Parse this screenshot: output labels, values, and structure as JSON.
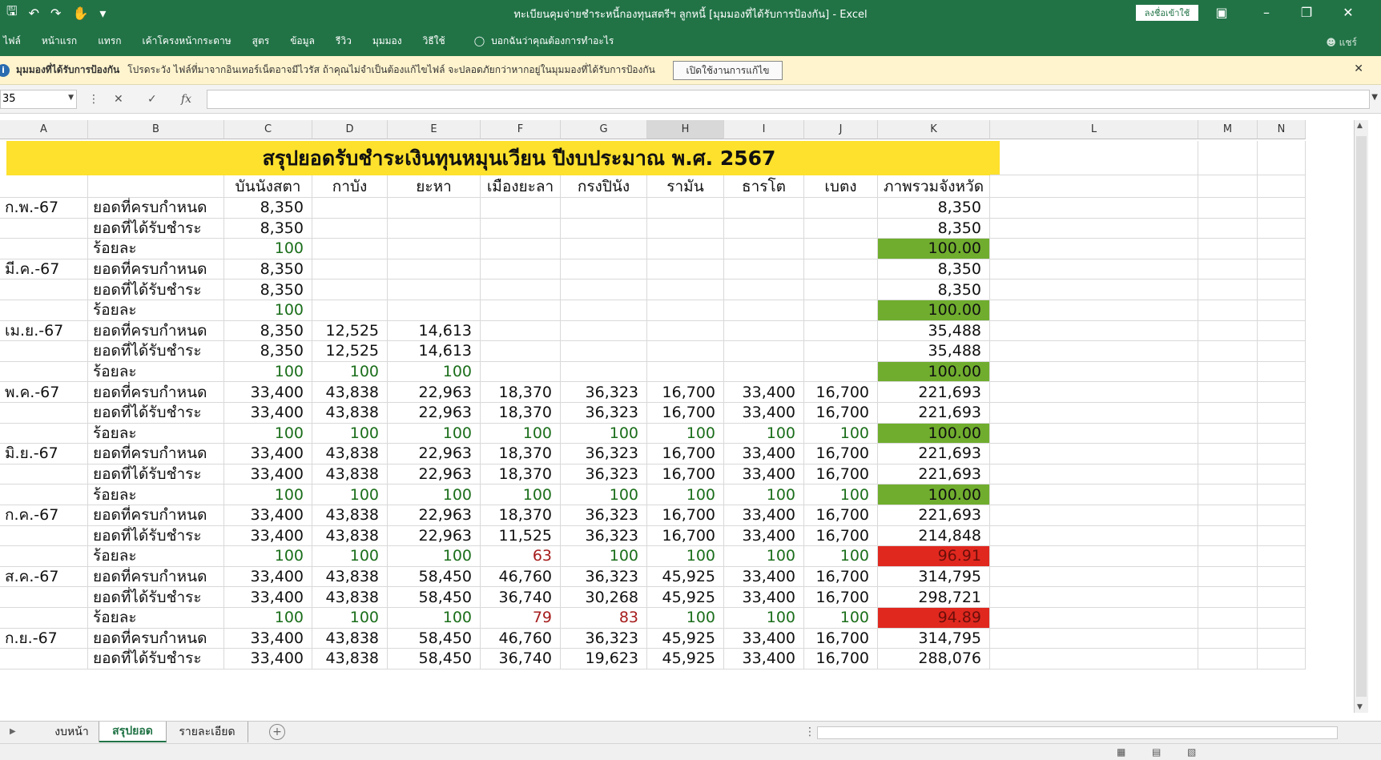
{
  "window": {
    "title": "ทะเบียนคุมจ่ายชำระหนี้กองทุนสตรีฯ ลูกหนี้  [มุมมองที่ได้รับการป้องกัน]  -  Excel",
    "signin_label": "ลงชื่อเข้าใช้"
  },
  "ribbon": {
    "tabs": [
      "ไฟล์",
      "หน้าแรก",
      "แทรก",
      "เค้าโครงหน้ากระดาษ",
      "สูตร",
      "ข้อมูล",
      "รีวิว",
      "มุมมอง",
      "วิธีใช้"
    ],
    "tell_me": "บอกฉันว่าคุณต้องการทำอะไร",
    "share": "แชร์"
  },
  "message_bar": {
    "title": "มุมมองที่ได้รับการป้องกัน",
    "text": "โปรดระวัง ไฟล์ที่มาจากอินเทอร์เน็ตอาจมีไวรัส ถ้าคุณไม่จำเป็นต้องแก้ไขไฟล์ จะปลอดภัยกว่าหากอยู่ในมุมมองที่ได้รับการป้องกัน",
    "button_label": "เปิดใช้งานการแก้ไข"
  },
  "formula_bar": {
    "name_box": "35",
    "formula": ""
  },
  "columns": [
    "A",
    "B",
    "C",
    "D",
    "E",
    "F",
    "G",
    "H",
    "I",
    "J",
    "K",
    "L",
    "M",
    "N"
  ],
  "selected_column": "H",
  "sheet": {
    "title": "สรุปยอดรับชำระเงินทุนหมุนเวียน ปีงบประมาณ พ.ศ. 2567",
    "headers": [
      "บันนังสตา",
      "กาบัง",
      "ยะหา",
      "เมืองยะลา",
      "กรงปินัง",
      "รามัน",
      "ธารโต",
      "เบตง",
      "ภาพรวมจังหวัด"
    ],
    "rows": [
      {
        "month": "ก.พ.-67",
        "label": "ยอดที่ครบกำหนด",
        "values": [
          "8,350",
          "",
          "",
          "",
          "",
          "",
          "",
          ""
        ],
        "total": "8,350",
        "kind": "amount"
      },
      {
        "month": "",
        "label": "ยอดที่ได้รับชำระ",
        "values": [
          "8,350",
          "",
          "",
          "",
          "",
          "",
          "",
          ""
        ],
        "total": "8,350",
        "kind": "amount"
      },
      {
        "month": "",
        "label": "ร้อยละ",
        "values": [
          "100",
          "",
          "",
          "",
          "",
          "",
          "",
          ""
        ],
        "total": "100.00",
        "kind": "pct",
        "status": "green"
      },
      {
        "month": "มี.ค.-67",
        "label": "ยอดที่ครบกำหนด",
        "values": [
          "8,350",
          "",
          "",
          "",
          "",
          "",
          "",
          ""
        ],
        "total": "8,350",
        "kind": "amount"
      },
      {
        "month": "",
        "label": "ยอดที่ได้รับชำระ",
        "values": [
          "8,350",
          "",
          "",
          "",
          "",
          "",
          "",
          ""
        ],
        "total": "8,350",
        "kind": "amount"
      },
      {
        "month": "",
        "label": "ร้อยละ",
        "values": [
          "100",
          "",
          "",
          "",
          "",
          "",
          "",
          ""
        ],
        "total": "100.00",
        "kind": "pct",
        "status": "green"
      },
      {
        "month": "เม.ย.-67",
        "label": "ยอดที่ครบกำหนด",
        "values": [
          "8,350",
          "12,525",
          "14,613",
          "",
          "",
          "",
          "",
          ""
        ],
        "total": "35,488",
        "kind": "amount"
      },
      {
        "month": "",
        "label": "ยอดที่ได้รับชำระ",
        "values": [
          "8,350",
          "12,525",
          "14,613",
          "",
          "",
          "",
          "",
          ""
        ],
        "total": "35,488",
        "kind": "amount"
      },
      {
        "month": "",
        "label": "ร้อยละ",
        "values": [
          "100",
          "100",
          "100",
          "",
          "",
          "",
          "",
          ""
        ],
        "total": "100.00",
        "kind": "pct",
        "status": "green"
      },
      {
        "month": "พ.ค.-67",
        "label": "ยอดที่ครบกำหนด",
        "values": [
          "33,400",
          "43,838",
          "22,963",
          "18,370",
          "36,323",
          "16,700",
          "33,400",
          "16,700"
        ],
        "total": "221,693",
        "kind": "amount"
      },
      {
        "month": "",
        "label": "ยอดที่ได้รับชำระ",
        "values": [
          "33,400",
          "43,838",
          "22,963",
          "18,370",
          "36,323",
          "16,700",
          "33,400",
          "16,700"
        ],
        "total": "221,693",
        "kind": "amount"
      },
      {
        "month": "",
        "label": "ร้อยละ",
        "values": [
          "100",
          "100",
          "100",
          "100",
          "100",
          "100",
          "100",
          "100"
        ],
        "total": "100.00",
        "kind": "pct",
        "status": "green"
      },
      {
        "month": "มิ.ย.-67",
        "label": "ยอดที่ครบกำหนด",
        "values": [
          "33,400",
          "43,838",
          "22,963",
          "18,370",
          "36,323",
          "16,700",
          "33,400",
          "16,700"
        ],
        "total": "221,693",
        "kind": "amount"
      },
      {
        "month": "",
        "label": "ยอดที่ได้รับชำระ",
        "values": [
          "33,400",
          "43,838",
          "22,963",
          "18,370",
          "36,323",
          "16,700",
          "33,400",
          "16,700"
        ],
        "total": "221,693",
        "kind": "amount"
      },
      {
        "month": "",
        "label": "ร้อยละ",
        "values": [
          "100",
          "100",
          "100",
          "100",
          "100",
          "100",
          "100",
          "100"
        ],
        "total": "100.00",
        "kind": "pct",
        "status": "green"
      },
      {
        "month": "ก.ค.-67",
        "label": "ยอดที่ครบกำหนด",
        "values": [
          "33,400",
          "43,838",
          "22,963",
          "18,370",
          "36,323",
          "16,700",
          "33,400",
          "16,700"
        ],
        "total": "221,693",
        "kind": "amount"
      },
      {
        "month": "",
        "label": "ยอดที่ได้รับชำระ",
        "values": [
          "33,400",
          "43,838",
          "22,963",
          "11,525",
          "36,323",
          "16,700",
          "33,400",
          "16,700"
        ],
        "total": "214,848",
        "kind": "amount"
      },
      {
        "month": "",
        "label": "ร้อยละ",
        "values": [
          "100",
          "100",
          "100",
          "63",
          "100",
          "100",
          "100",
          "100"
        ],
        "total": "96.91",
        "kind": "pct",
        "status": "red"
      },
      {
        "month": "ส.ค.-67",
        "label": "ยอดที่ครบกำหนด",
        "values": [
          "33,400",
          "43,838",
          "58,450",
          "46,760",
          "36,323",
          "45,925",
          "33,400",
          "16,700"
        ],
        "total": "314,795",
        "kind": "amount"
      },
      {
        "month": "",
        "label": "ยอดที่ได้รับชำระ",
        "values": [
          "33,400",
          "43,838",
          "58,450",
          "36,740",
          "30,268",
          "45,925",
          "33,400",
          "16,700"
        ],
        "total": "298,721",
        "kind": "amount"
      },
      {
        "month": "",
        "label": "ร้อยละ",
        "values": [
          "100",
          "100",
          "100",
          "79",
          "83",
          "100",
          "100",
          "100"
        ],
        "total": "94.89",
        "kind": "pct",
        "status": "red"
      },
      {
        "month": "ก.ย.-67",
        "label": "ยอดที่ครบกำหนด",
        "values": [
          "33,400",
          "43,838",
          "58,450",
          "46,760",
          "36,323",
          "45,925",
          "33,400",
          "16,700"
        ],
        "total": "314,795",
        "kind": "amount"
      },
      {
        "month": "",
        "label": "ยอดที่ได้รับชำระ",
        "values": [
          "33,400",
          "43,838",
          "58,450",
          "36,740",
          "19,623",
          "45,925",
          "33,400",
          "16,700"
        ],
        "total": "288,076",
        "kind": "amount"
      }
    ]
  },
  "sheet_tabs": [
    {
      "label": "งบหน้า",
      "active": false
    },
    {
      "label": "สรุปยอด",
      "active": true
    },
    {
      "label": "รายละเอียด",
      "active": false
    }
  ],
  "colors": {
    "excel_green": "#217346",
    "title_yellow": "#fde12d",
    "pass_green": "#70ad2e",
    "fail_red": "#e0281f"
  }
}
